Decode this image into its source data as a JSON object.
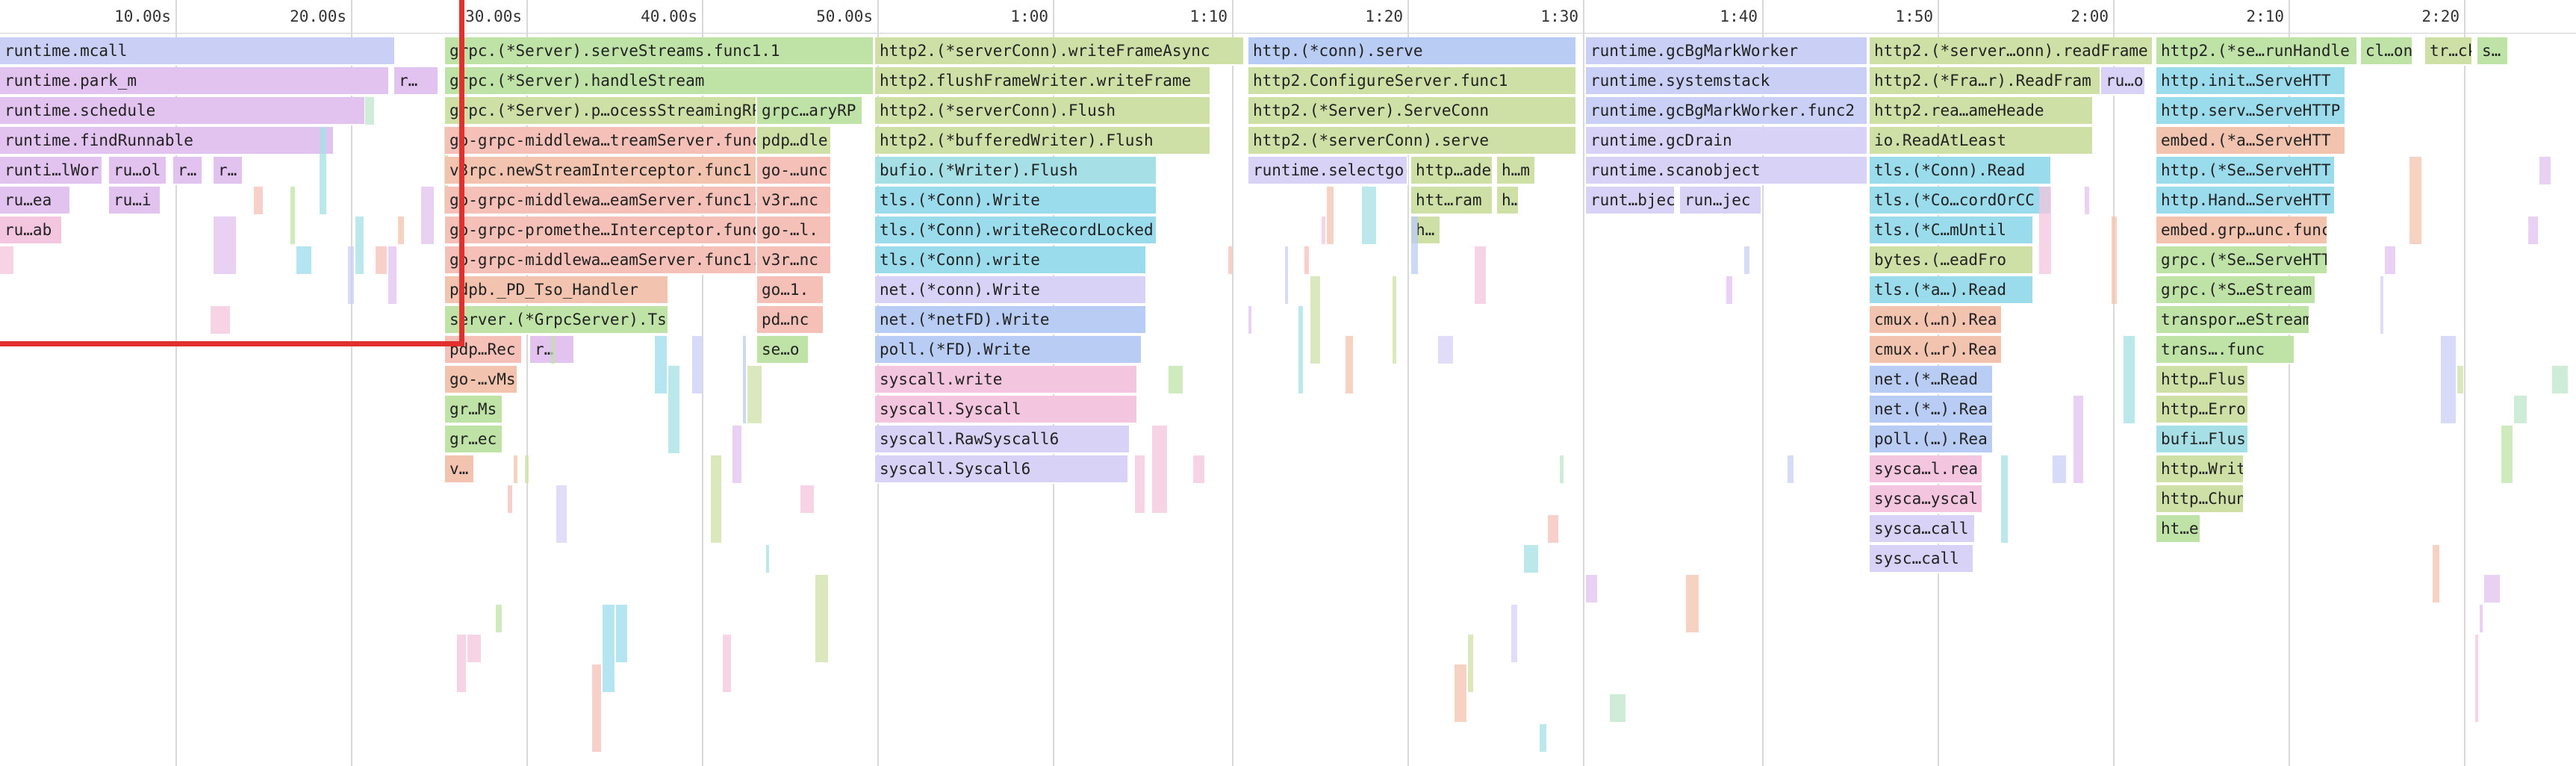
{
  "palette": {
    "lavender": "#c9cff5",
    "purple": "#e2c2ef",
    "pink": "#f3c5de",
    "green": "#bfe3a6",
    "olive": "#cfe0a7",
    "teal": "#a6e0e6",
    "cyan": "#9bdcec",
    "blue": "#b9ccf4",
    "peach": "#f2c3ae",
    "salmon": "#f5c0b8",
    "mint": "#bfe6cc",
    "lilac": "#d7d2f6",
    "selection": "#e0312e"
  },
  "timeline": {
    "ticks": [
      "10.00s",
      "20.00s",
      "30.00s",
      "40.00s",
      "50.00s",
      "1:00",
      "1:10",
      "1:20",
      "1:30",
      "1:40",
      "1:50",
      "2:00",
      "2:10",
      "2:20"
    ]
  },
  "columns": [
    {
      "frames": [
        "runtime.mcall",
        "runtime.park_m",
        "runtime.schedule",
        "runtime.findRunnable",
        "runti…lWor",
        "ru…ea",
        "ru…ab"
      ]
    },
    {
      "frames": [
        "grpc.(*Server).serveStreams.func1.1",
        "grpc.(*Server).handleStream",
        "grpc.(*Server).p…ocessStreamingRP",
        "go-grpc-middlewa…treamServer.func",
        "v3rpc.newStreamInterceptor.func1",
        "go-grpc-middlewa…eamServer.func1.",
        "go-grpc-promethe…Interceptor.func",
        "go-grpc-middlewa…eamServer.func1.",
        "pdpb._PD_Tso_Handler",
        "server.(*GrpcServer).Tso",
        "pdp…Rec",
        "go-…vMs",
        "gr…Ms",
        "gr…ec",
        "v…"
      ]
    },
    {
      "frames": [
        "grpc…aryRP",
        "pdp…dle",
        "go-…unc",
        "v3r…nc",
        "go-…l.",
        "v3r…nc",
        "go…1.",
        "pd…nc",
        "se…o"
      ]
    },
    {
      "frames": [
        "http2.(*serverConn).writeFrameAsync",
        "http2.flushFrameWriter.writeFrame",
        "http2.(*serverConn).Flush",
        "http2.(*bufferedWriter).Flush",
        "bufio.(*Writer).Flush",
        "tls.(*Conn).Write",
        "tls.(*Conn).writeRecordLocked",
        "tls.(*Conn).write",
        "net.(*conn).Write",
        "net.(*netFD).Write",
        "poll.(*FD).Write",
        "syscall.write",
        "syscall.Syscall",
        "syscall.RawSyscall6",
        "syscall.Syscall6"
      ]
    },
    {
      "frames": [
        "http.(*conn).serve",
        "http2.ConfigureServer.func1",
        "http2.(*Server).ServeConn",
        "http2.(*serverConn).serve",
        "runtime.selectgo"
      ]
    },
    {
      "frames": [
        "runtime.gcBgMarkWorker",
        "runtime.systemstack",
        "runtime.gcBgMarkWorker.func2",
        "runtime.gcDrain",
        "runtime.scanobject",
        "runt…bjec",
        "run…jec"
      ]
    },
    {
      "frames": [
        "http2.(*server…onn).readFrame",
        "http2.(*Fra…r).ReadFram",
        "http2.rea…ameHeade",
        "io.ReadAtLeast",
        "tls.(*Conn).Read",
        "tls.(*Co…cordOrCC",
        "tls.(*C…mUntil",
        "bytes.(…eadFro",
        "tls.(*a…).Read",
        "cmux.(…n).Rea",
        "cmux.(…r).Rea",
        "net.(*…Read",
        "net.(*…).Rea",
        "poll.(…).Rea",
        "sysca…l.rea",
        "sysca…yscal",
        "sysca…call",
        "sysc…call"
      ]
    },
    {
      "frames": [
        "http2.(*se…runHandle",
        "http.init…ServeHTT",
        "http.serv…ServeHTTP",
        "embed.(*a…ServeHTT",
        "http.(*Se…ServeHTT",
        "http.Hand…ServeHTT",
        "embed.grp…unc.func",
        "grpc.(*Se…ServeHTT",
        "grpc.(*S…eStream",
        "transpor…eStream",
        "trans….func",
        "http…Flus",
        "http…Erro",
        "bufi…Flus",
        "http…Writ",
        "http…Chun",
        "ht…e"
      ]
    },
    {
      "frames": [
        "r…",
        "ru…ol",
        "ru…i",
        "r…",
        "r…",
        "htt…ram",
        "http…ade",
        "h…m",
        "h…",
        "h…",
        "ru…o",
        "cl…on",
        "tr…ck",
        "s…"
      ]
    }
  ]
}
